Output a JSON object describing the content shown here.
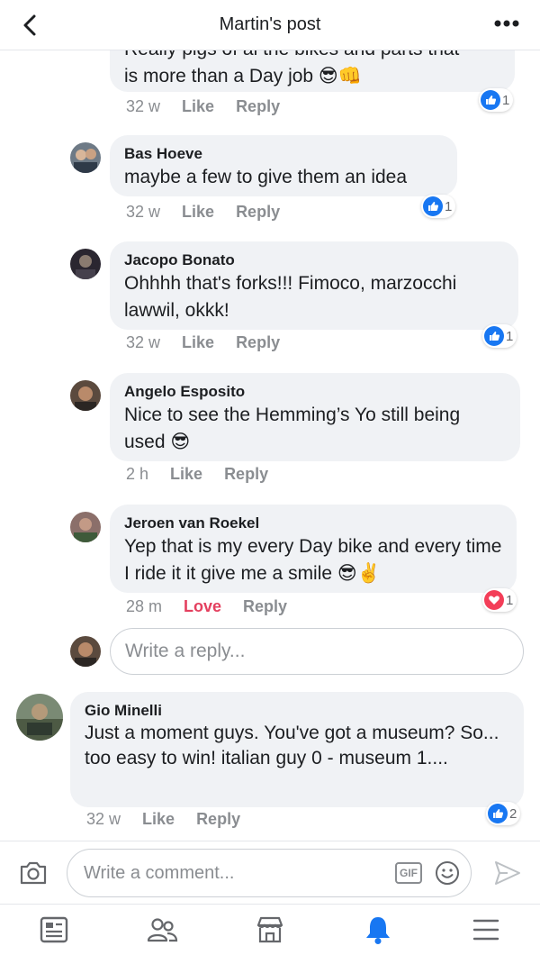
{
  "header": {
    "title": "Martin's post",
    "back_icon": "chevron-left-icon",
    "more_icon": "more-horizontal-icon"
  },
  "comments": [
    {
      "author": "",
      "text_clipped": "Really pigs of al the bikes and parts that",
      "text": "is more than a Day job 😎👊",
      "time": "32 w",
      "like_label": "Like",
      "reply_label": "Reply",
      "reaction_type": "like",
      "reaction_count": "1"
    },
    {
      "author": "Bas Hoeve",
      "text": "maybe a few to give them an idea",
      "time": "32 w",
      "like_label": "Like",
      "reply_label": "Reply",
      "reaction_type": "like",
      "reaction_count": "1"
    },
    {
      "author": "Jacopo Bonato",
      "text": "Ohhhh that's forks!!! Fimoco, marzocchi lawwil, okkk!",
      "time": "32 w",
      "like_label": "Like",
      "reply_label": "Reply",
      "reaction_type": "like",
      "reaction_count": "1"
    },
    {
      "author": "Angelo Esposito",
      "text": "Nice to see the Hemming’s Yo still being used 😎",
      "time": "2 h",
      "like_label": "Like",
      "reply_label": "Reply"
    },
    {
      "author": "Jeroen van Roekel",
      "text": "Yep that is my every Day bike and every time I ride it it give me a smile 😎✌️",
      "time": "28 m",
      "like_label": "Love",
      "reply_label": "Reply",
      "reaction_type": "love",
      "reaction_count": "1"
    }
  ],
  "reply_input": {
    "placeholder": "Write a reply..."
  },
  "top_comment": {
    "author": "Gio Minelli",
    "text": "Just a moment guys. You've got a museum? So... too easy to win!  italian guy 0 - museum 1....",
    "time": "32 w",
    "like_label": "Like",
    "reply_label": "Reply",
    "reaction_type": "like",
    "reaction_count": "2"
  },
  "composer": {
    "placeholder": "Write a comment...",
    "gif_label": "GIF",
    "camera_icon": "camera-icon",
    "emoji_icon": "smiley-icon",
    "send_icon": "send-icon"
  },
  "tabbar": {
    "items": [
      "news-feed-icon",
      "friends-icon",
      "marketplace-icon",
      "notifications-icon",
      "menu-icon"
    ],
    "active": "notifications-icon",
    "accent": "#1877f2"
  }
}
